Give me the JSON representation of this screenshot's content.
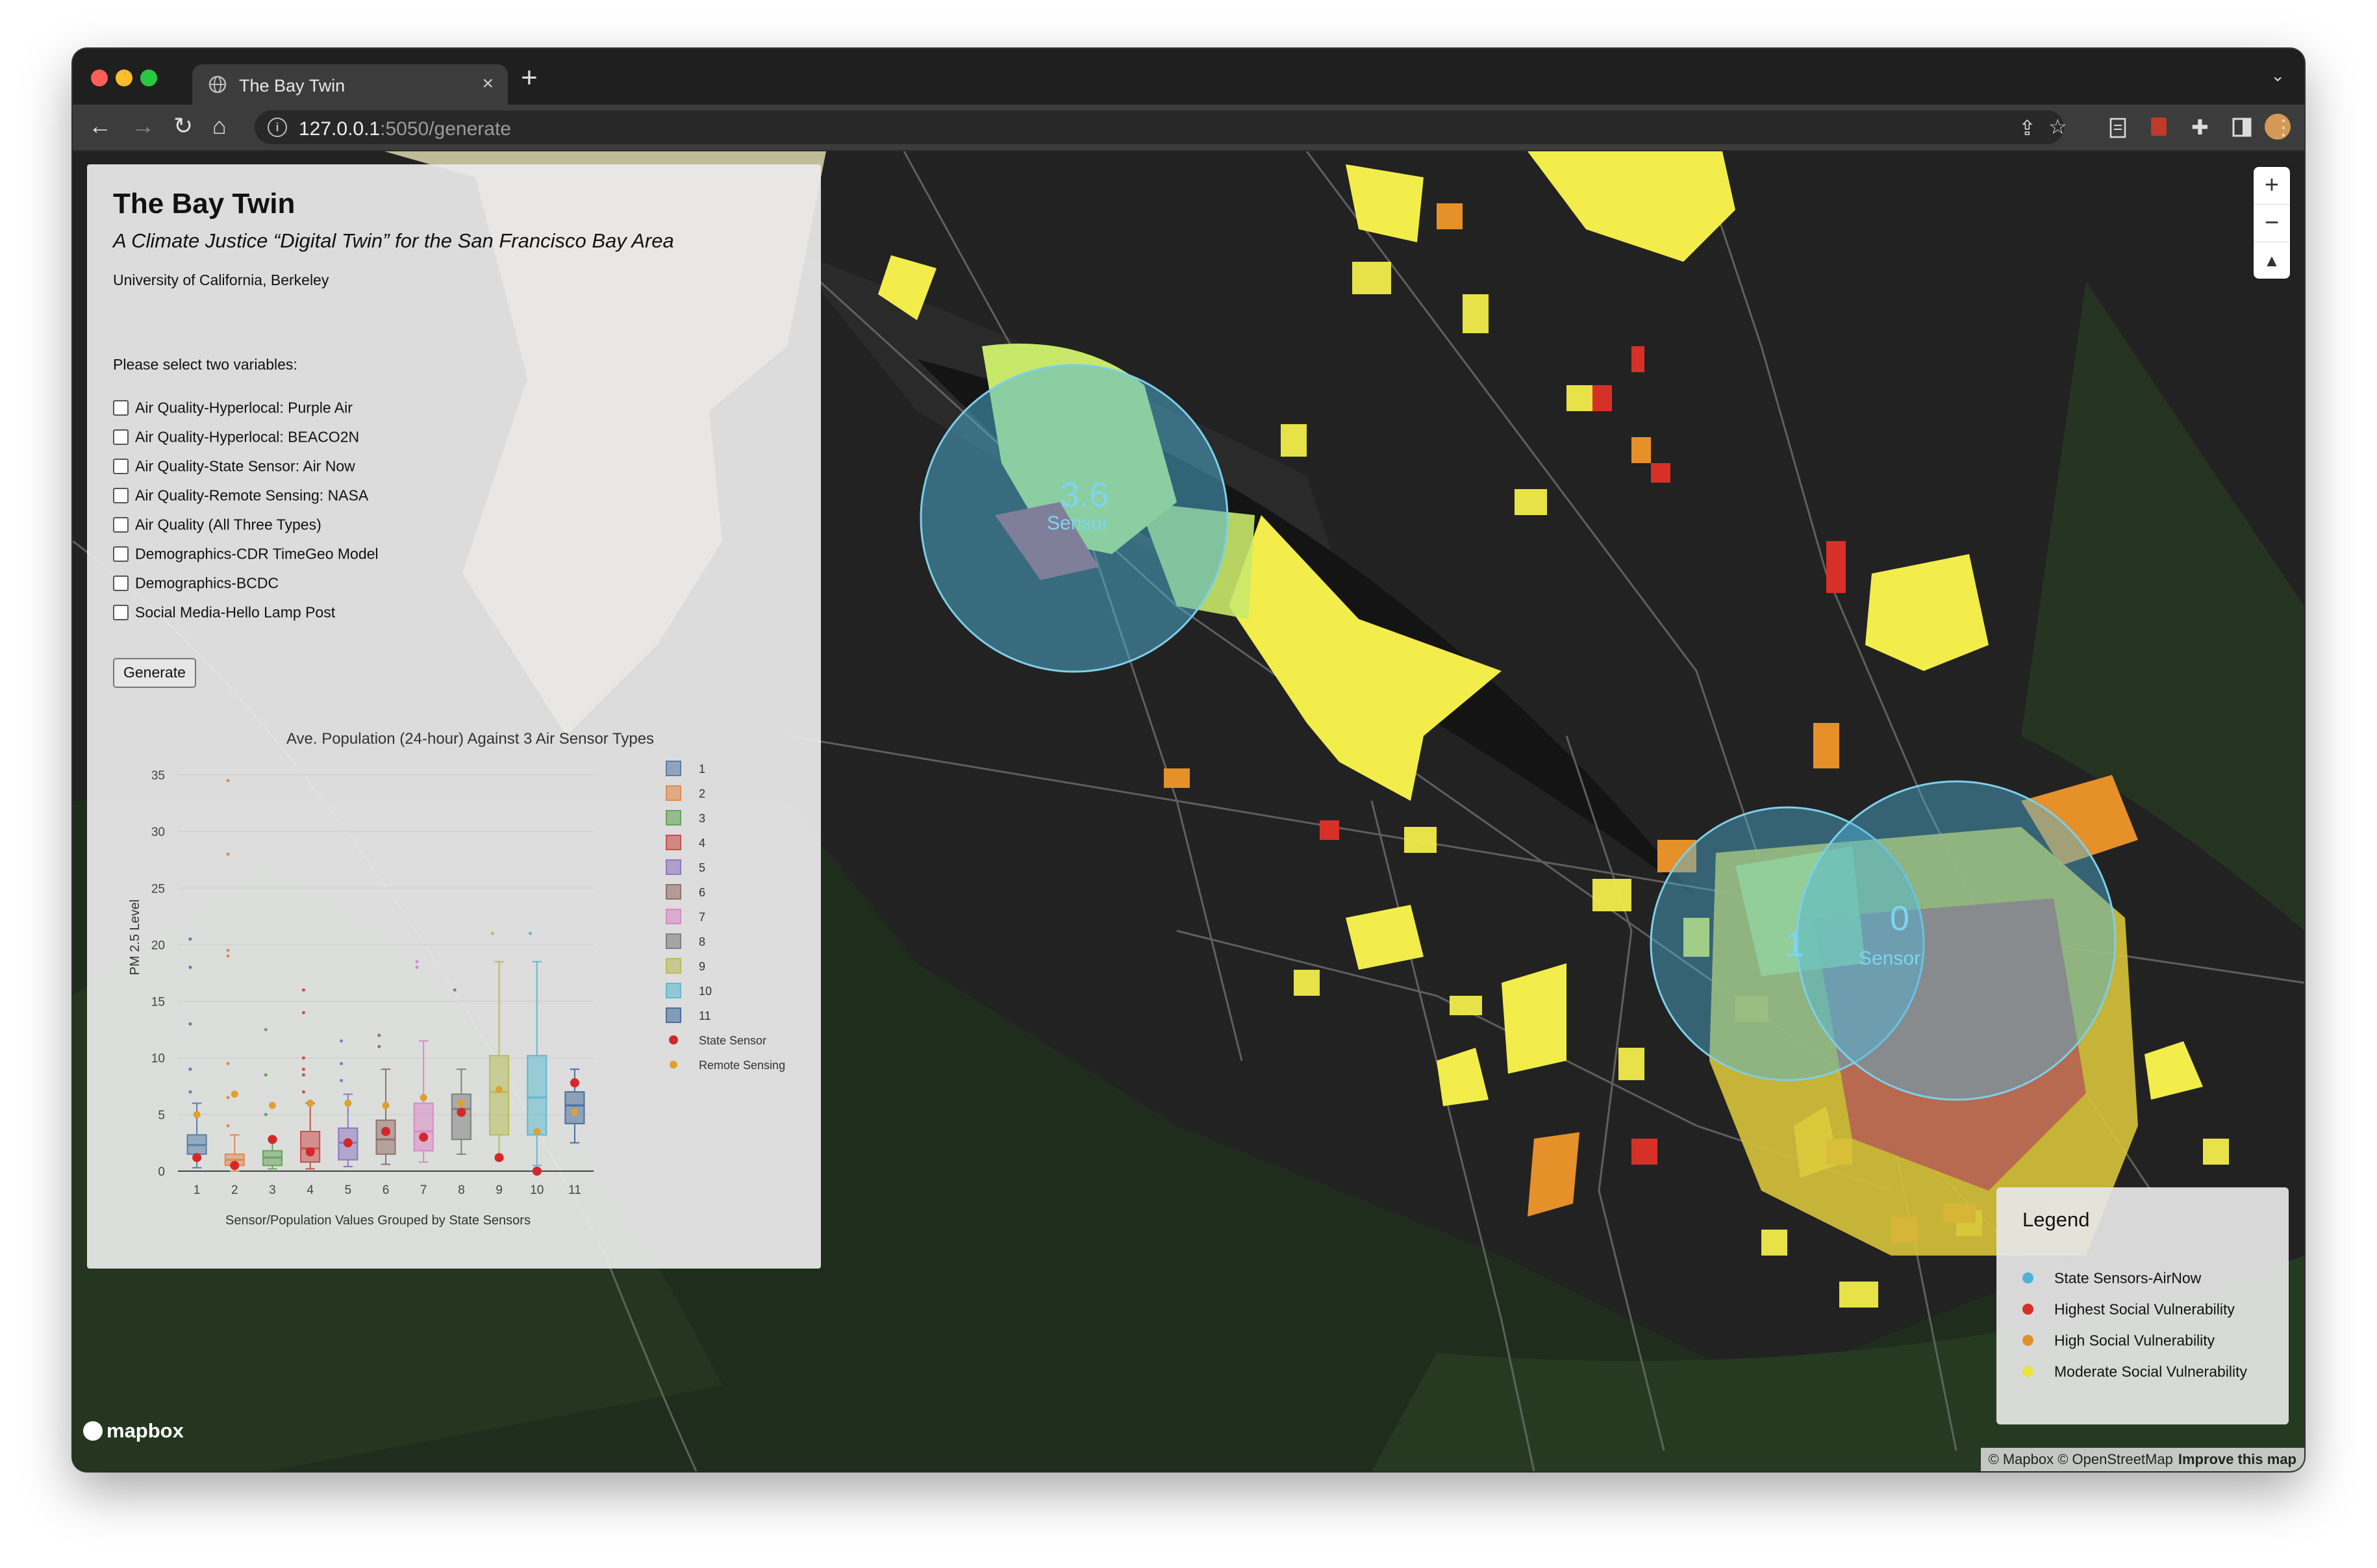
{
  "browser": {
    "tab_title": "The Bay Twin",
    "url_host": "127.0.0.1",
    "url_rest": ":5050/generate"
  },
  "panel": {
    "title": "The Bay Twin",
    "subtitle": "A Climate Justice “Digital Twin” for the San Francisco Bay Area",
    "org": "University of California, Berkeley",
    "prompt": "Please select two variables:",
    "options": [
      "Air Quality-Hyperlocal: Purple Air",
      "Air Quality-Hyperlocal: BEACO2N",
      "Air Quality-State Sensor: Air Now",
      "Air Quality-Remote Sensing: NASA",
      "Air Quality (All Three Types)",
      "Demographics-CDR TimeGeo Model",
      "Demographics-BCDC",
      "Social Media-Hello Lamp Post"
    ],
    "generate_label": "Generate"
  },
  "chart_data": {
    "type": "box",
    "title": "Ave. Population (24-hour) Against 3 Air Sensor Types",
    "xlabel": "Sensor/Population Values Grouped by State Sensors",
    "ylabel": "PM 2.5 Level",
    "ylim": [
      0,
      35
    ],
    "yticks": [
      0,
      5,
      10,
      15,
      20,
      25,
      30,
      35
    ],
    "categories": [
      "1",
      "2",
      "3",
      "4",
      "5",
      "6",
      "7",
      "8",
      "9",
      "10",
      "11"
    ],
    "series": [
      {
        "name": "1",
        "color": "#5b7fa8",
        "q1": 1.5,
        "median": 2.3,
        "q3": 3.2,
        "min": 0.3,
        "max": 6.0,
        "outliers": [
          7,
          9,
          13,
          18,
          20.5
        ]
      },
      {
        "name": "2",
        "color": "#e08b4f",
        "q1": 0.5,
        "median": 1.0,
        "q3": 1.5,
        "min": 0,
        "max": 3.2,
        "outliers": [
          4,
          6.5,
          9.5,
          19,
          19.5,
          28,
          34.5
        ]
      },
      {
        "name": "3",
        "color": "#66a55c",
        "q1": 0.5,
        "median": 1.2,
        "q3": 1.8,
        "min": 0.2,
        "max": 2.8,
        "outliers": [
          5,
          8.5,
          12.5
        ]
      },
      {
        "name": "4",
        "color": "#c8504c",
        "q1": 0.8,
        "median": 2.0,
        "q3": 3.5,
        "min": 0.2,
        "max": 6.0,
        "outliers": [
          7,
          8.5,
          9,
          10,
          14,
          16
        ]
      },
      {
        "name": "5",
        "color": "#8e79c0",
        "q1": 1.0,
        "median": 2.5,
        "q3": 3.8,
        "min": 0.4,
        "max": 6.8,
        "outliers": [
          8,
          9.5,
          11.5
        ]
      },
      {
        "name": "6",
        "color": "#93736a",
        "q1": 1.5,
        "median": 2.8,
        "q3": 4.5,
        "min": 0.6,
        "max": 9.0,
        "outliers": [
          11,
          12
        ]
      },
      {
        "name": "7",
        "color": "#d88bc6",
        "q1": 1.8,
        "median": 3.5,
        "q3": 6.0,
        "min": 0.8,
        "max": 11.5,
        "outliers": [
          18,
          18.5
        ]
      },
      {
        "name": "8",
        "color": "#808080",
        "q1": 2.8,
        "median": 5.5,
        "q3": 6.8,
        "min": 1.5,
        "max": 9.0,
        "outliers": [
          16
        ]
      },
      {
        "name": "9",
        "color": "#b9bd5a",
        "q1": 3.2,
        "median": 7.0,
        "q3": 10.2,
        "min": 1.0,
        "max": 18.5,
        "outliers": [
          21
        ]
      },
      {
        "name": "10",
        "color": "#5fbbcf",
        "q1": 3.2,
        "median": 6.5,
        "q3": 10.2,
        "min": 0.5,
        "max": 18.5,
        "outliers": [
          21
        ]
      },
      {
        "name": "11",
        "color": "#4a6f9d",
        "q1": 4.2,
        "median": 5.8,
        "q3": 7.0,
        "min": 2.5,
        "max": 9.0,
        "outliers": []
      }
    ],
    "state_sensor": [
      1.2,
      0.5,
      2.8,
      1.7,
      2.5,
      3.5,
      3.0,
      5.2,
      1.2,
      0,
      7.8
    ],
    "remote_sensing": [
      5.0,
      6.8,
      5.8,
      6.0,
      6.0,
      5.8,
      6.5,
      6.0,
      7.2,
      3.5,
      5.2
    ],
    "legend": [
      "1",
      "2",
      "3",
      "4",
      "5",
      "6",
      "7",
      "8",
      "9",
      "10",
      "11",
      "State Sensor",
      "Remote Sensing"
    ],
    "state_color": "#d62728",
    "remote_color": "#e0a030"
  },
  "map": {
    "circle_labels": [
      "3.6",
      "Sensor",
      "1",
      "0",
      "Sensor"
    ],
    "legend_title": "Legend",
    "legend_items": [
      {
        "label": "State Sensors-AirNow",
        "color": "#4db3d9"
      },
      {
        "label": "Highest Social Vulnerability",
        "color": "#d73027"
      },
      {
        "label": "High Social Vulnerability",
        "color": "#e0902b"
      },
      {
        "label": "Moderate Social Vulnerability",
        "color": "#e8e43a"
      }
    ],
    "logo": "mapbox",
    "attribution": "© Mapbox © OpenStreetMap",
    "improve": "Improve this map"
  }
}
